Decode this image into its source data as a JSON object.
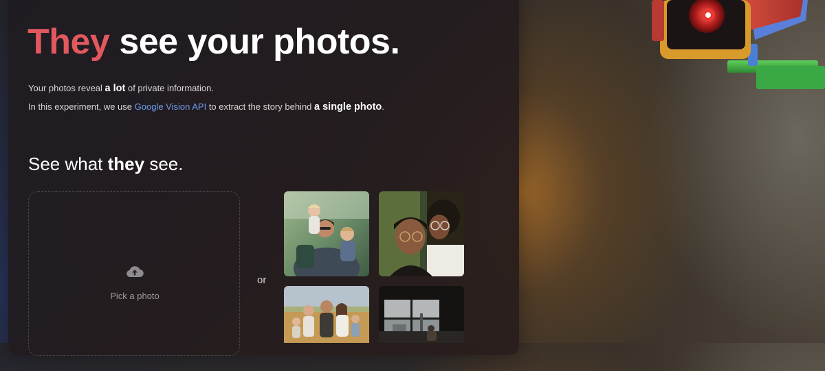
{
  "hero": {
    "headline_accent": "They",
    "headline_rest": " see your photos.",
    "accent_color": "#e2585f"
  },
  "intro": {
    "line1_pre": "Your photos reveal ",
    "line1_bold": "a lot",
    "line1_post": " of private information.",
    "line2_pre": "In this experiment, we use ",
    "line2_link": "Google Vision API",
    "line2_mid": " to extract the story behind ",
    "line2_bold": "a single photo",
    "line2_post": ".",
    "link_color": "#6f9cf2"
  },
  "section": {
    "pre": "See what ",
    "bold": "they",
    "post": " see."
  },
  "upload": {
    "label": "Pick a photo",
    "icon": "cloud-upload-icon"
  },
  "divider_label": "or",
  "samples": {
    "icons": [
      "family-photo",
      "couple-photo",
      "family-field-photo",
      "window-interior-photo"
    ]
  },
  "decor": {
    "camera_icon": "security-camera-icon"
  }
}
